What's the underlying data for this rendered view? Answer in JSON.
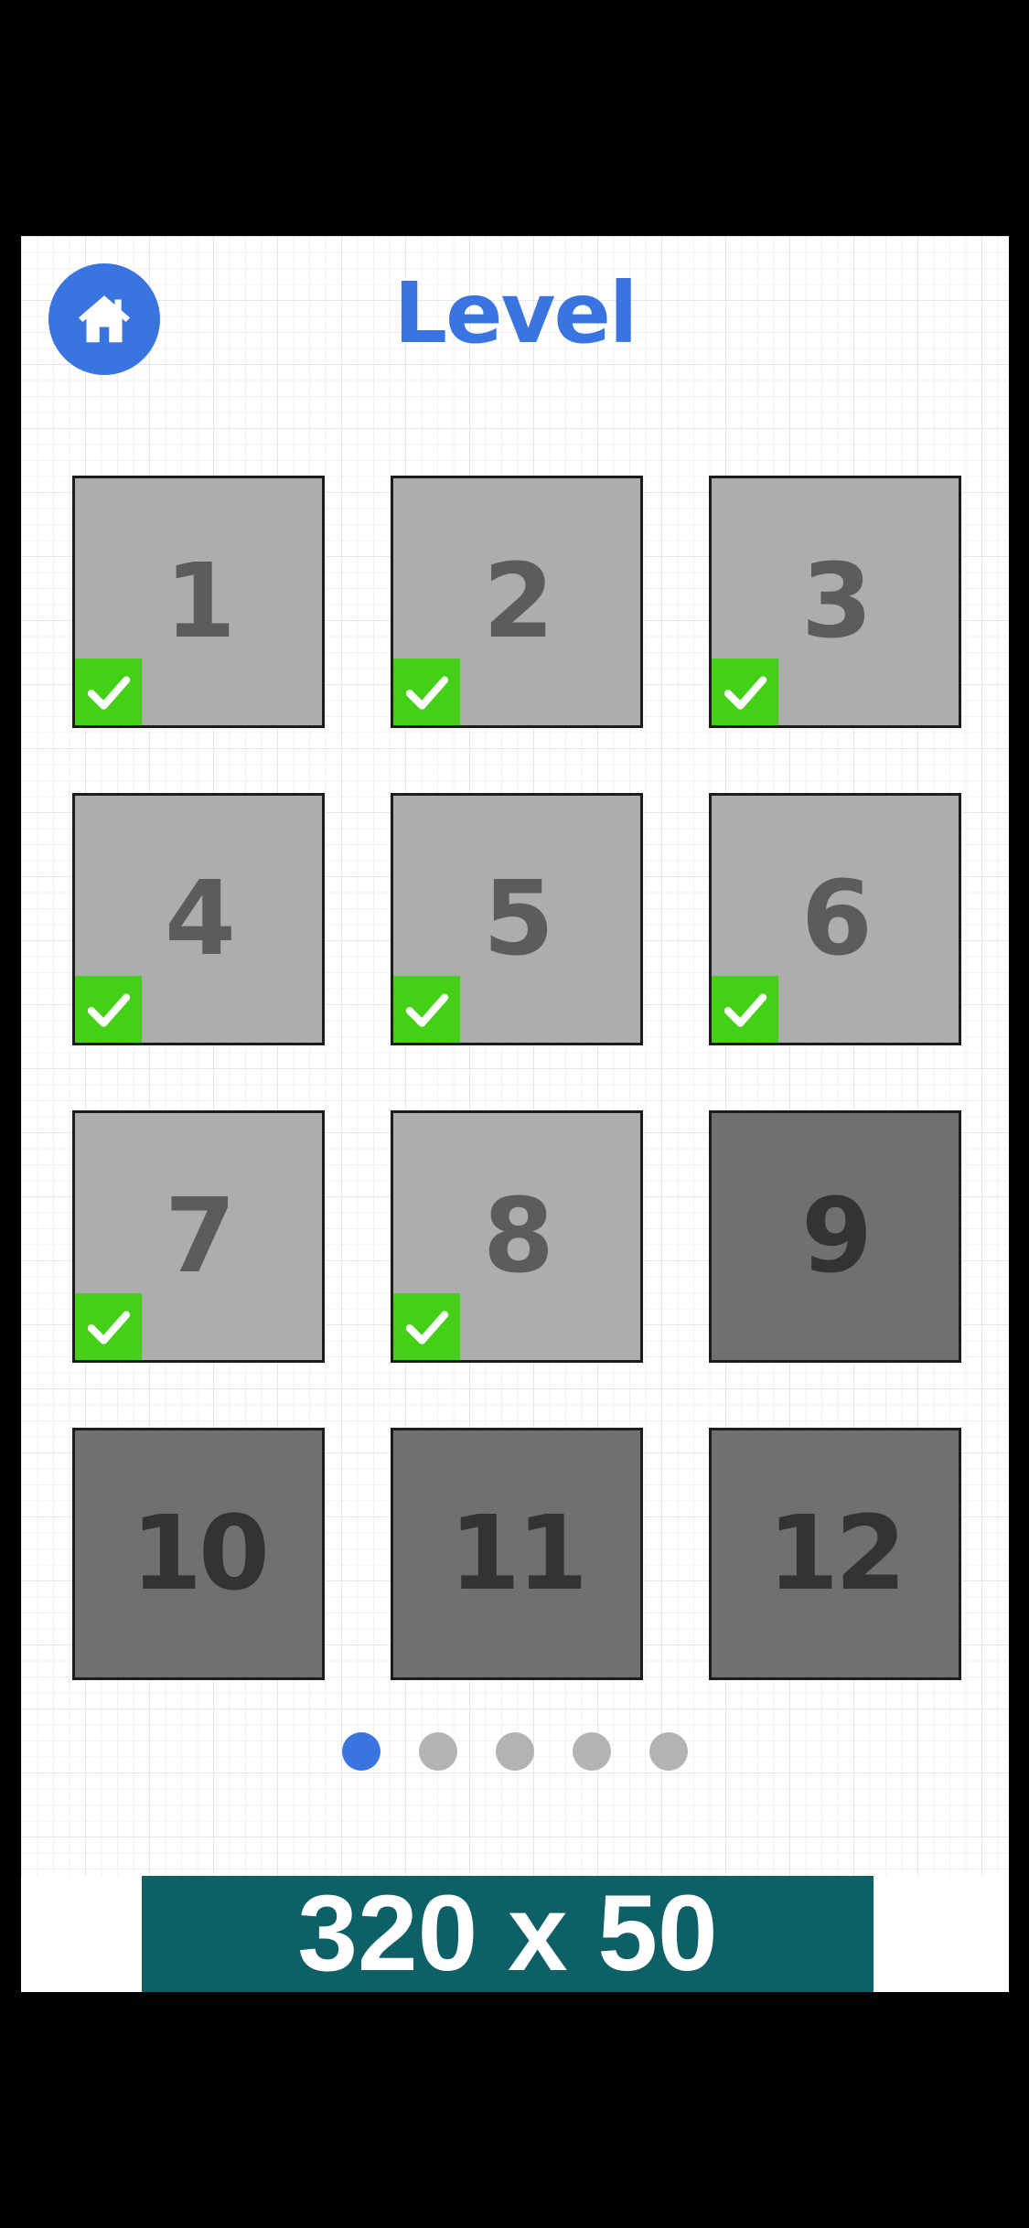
{
  "header": {
    "title": "Level",
    "home_icon": "home-icon"
  },
  "levels": [
    {
      "number": "1",
      "completed": true,
      "locked": false
    },
    {
      "number": "2",
      "completed": true,
      "locked": false
    },
    {
      "number": "3",
      "completed": true,
      "locked": false
    },
    {
      "number": "4",
      "completed": true,
      "locked": false
    },
    {
      "number": "5",
      "completed": true,
      "locked": false
    },
    {
      "number": "6",
      "completed": true,
      "locked": false
    },
    {
      "number": "7",
      "completed": true,
      "locked": false
    },
    {
      "number": "8",
      "completed": true,
      "locked": false
    },
    {
      "number": "9",
      "completed": false,
      "locked": true
    },
    {
      "number": "10",
      "completed": false,
      "locked": true
    },
    {
      "number": "11",
      "completed": false,
      "locked": true
    },
    {
      "number": "12",
      "completed": false,
      "locked": true
    }
  ],
  "pagination": {
    "page_count": 5,
    "active_page": 1
  },
  "ad": {
    "label": "320 x 50"
  },
  "colors": {
    "accent": "#3a74e0",
    "check": "#44d016",
    "unlocked_tile": "#adadad",
    "locked_tile": "#707070",
    "ad_background": "#0d6065"
  }
}
